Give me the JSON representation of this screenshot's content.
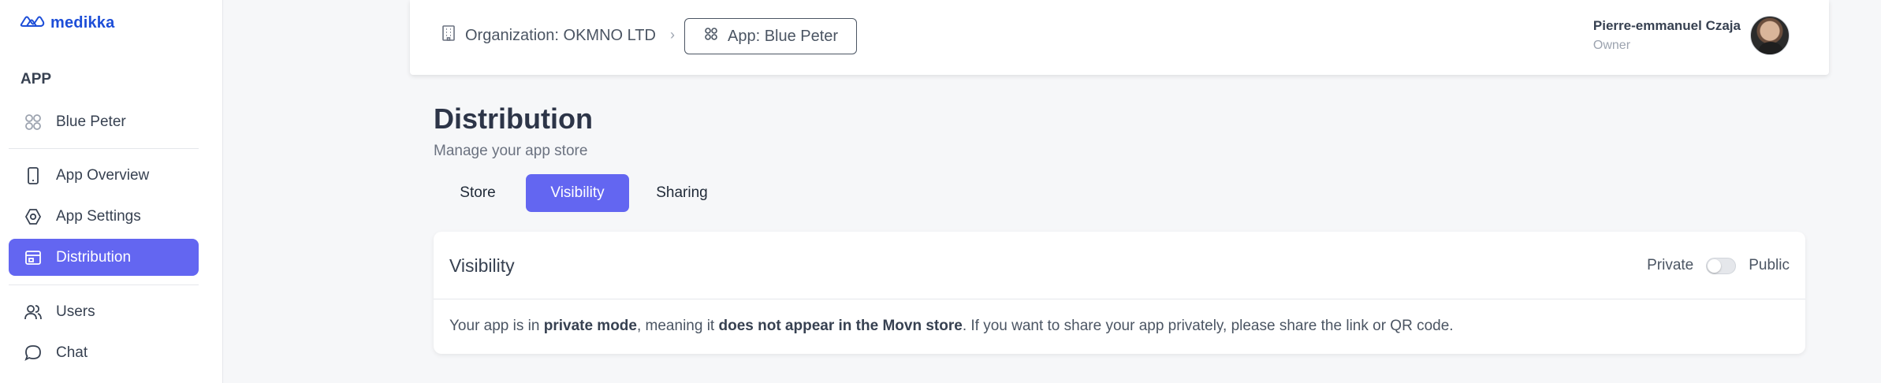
{
  "brand": {
    "name": "medikka",
    "logo_icon": "medikka-logo-icon",
    "color": "#1d4ed8"
  },
  "sidebar": {
    "section_label": "APP",
    "app_item": {
      "label": "Blue Peter",
      "icon": "app-grid-icon"
    },
    "items": [
      {
        "label": "App Overview",
        "icon": "phone-icon",
        "active": false
      },
      {
        "label": "App Settings",
        "icon": "gear-icon",
        "active": false
      },
      {
        "label": "Distribution",
        "icon": "store-icon",
        "active": true
      }
    ],
    "secondary_items": [
      {
        "label": "Users",
        "icon": "users-icon"
      },
      {
        "label": "Chat",
        "icon": "chat-bubble-icon"
      }
    ]
  },
  "header": {
    "breadcrumb": {
      "organization": "Organization: OKMNO LTD",
      "separator": "›",
      "app": "App: Blue Peter"
    },
    "user": {
      "name": "Pierre-emmanuel Czaja",
      "role": "Owner"
    }
  },
  "main": {
    "title": "Distribution",
    "subtitle": "Manage your app store",
    "tabs": [
      {
        "label": "Store",
        "active": false
      },
      {
        "label": "Visibility",
        "active": true
      },
      {
        "label": "Sharing",
        "active": false
      }
    ],
    "card": {
      "title": "Visibility",
      "toggle": {
        "left_label": "Private",
        "right_label": "Public",
        "value": "Private"
      },
      "message": {
        "part1": "Your app is in ",
        "bold1": "private mode",
        "part2": ", meaning it ",
        "bold2": "does not appear in the Movn store",
        "part3": ". If you want to share your app privately, please share the link or QR code."
      }
    }
  },
  "colors": {
    "accent": "#6366f1",
    "background": "#f6f7f9",
    "text": "#374151"
  }
}
